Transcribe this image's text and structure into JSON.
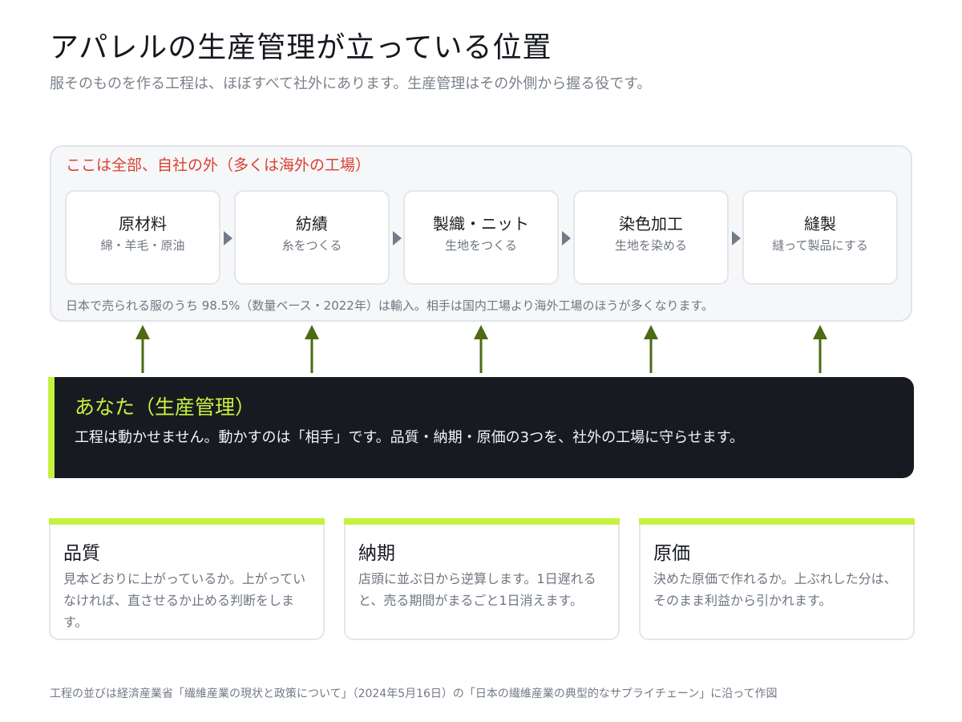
{
  "header": {
    "title": "アパレルの生産管理が立っている位置",
    "subtitle": "服そのものを作る工程は、ほぼすべて社外にあります。生産管理はその外側から握る役です。"
  },
  "outside": {
    "heading": "ここは全部、自社の外（多くは海外の工場）",
    "steps": [
      {
        "title": "原材料",
        "sub": "綿・羊毛・原油"
      },
      {
        "title": "紡績",
        "sub": "糸をつくる"
      },
      {
        "title": "製織・ニット",
        "sub": "生地をつくる"
      },
      {
        "title": "染色加工",
        "sub": "生地を染める"
      },
      {
        "title": "縫製",
        "sub": "縫って製品にする"
      }
    ],
    "note": "日本で売られる服のうち 98.5%（数量ベース・2022年）は輸入。相手は国内工場より海外工場のほうが多くなります。"
  },
  "you": {
    "title": "あなた（生産管理）",
    "desc": "工程は動かせません。動かすのは「相手」です。品質・納期・原価の3つを、社外の工場に守らせます。"
  },
  "cards": [
    {
      "title": "品質",
      "body": "見本どおりに上がっているか。上がっていなければ、直させるか止める判断をします。"
    },
    {
      "title": "納期",
      "body": "店頭に並ぶ日から逆算します。1日遅れると、売る期間がまるごと1日消えます。"
    },
    {
      "title": "原価",
      "body": "決めた原価で作れるか。上ぶれした分は、そのまま利益から引かれます。"
    }
  ],
  "source": "工程の並びは経済産業省「繊維産業の現状と政策について」（2024年5月16日）の「日本の繊維産業の典型的なサプライチェーン」に沿って作図",
  "colors": {
    "accent": "#c5f23e",
    "arrow": "#4d6b12",
    "warning_text": "#d9412f",
    "dark_panel": "#171a21"
  }
}
